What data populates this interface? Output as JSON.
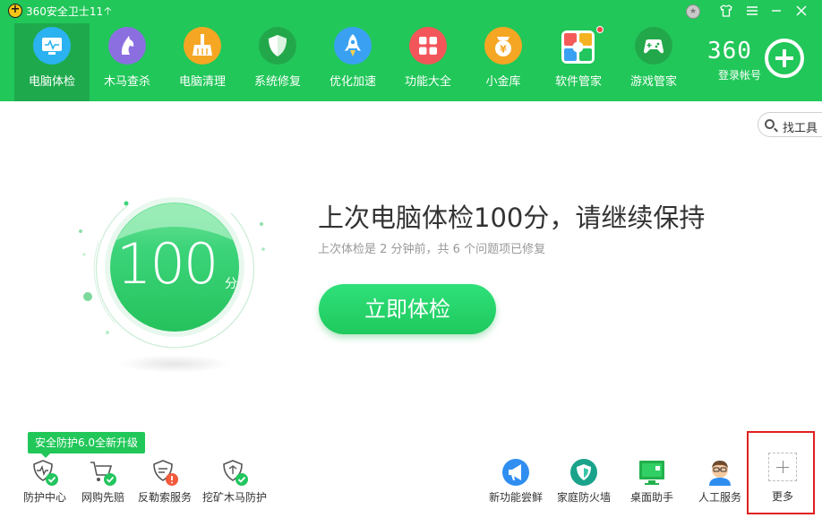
{
  "titlebar": {
    "title": "360安全卫士11",
    "update_icon": "up-arrow-icon",
    "controls": [
      "medal-icon",
      "skin-icon",
      "menu-icon",
      "minimize-icon",
      "close-icon"
    ]
  },
  "nav": {
    "tabs": [
      {
        "label": "电脑体检",
        "icon": "monitor-check-icon",
        "color": "#2bb2f0",
        "active": true
      },
      {
        "label": "木马查杀",
        "icon": "horse-icon",
        "color": "#8b6fe0"
      },
      {
        "label": "电脑清理",
        "icon": "broom-icon",
        "color": "#f5a623"
      },
      {
        "label": "系统修复",
        "icon": "shield-icon",
        "color": "#22a84a"
      },
      {
        "label": "优化加速",
        "icon": "rocket-icon",
        "color": "#3aa1f2"
      },
      {
        "label": "功能大全",
        "icon": "grid-icon",
        "color": "#f2555a"
      },
      {
        "label": "小金库",
        "icon": "coin-icon",
        "color": "#f5a623"
      },
      {
        "label": "软件管家",
        "icon": "apps-icon",
        "color": "#ffffff"
      },
      {
        "label": "游戏管家",
        "icon": "gamepad-icon",
        "color": "#22a84a"
      }
    ],
    "login": {
      "brand": "360",
      "label": "登录帐号"
    }
  },
  "main": {
    "find_tools": "找工具",
    "score": "100",
    "score_unit": "分",
    "headline": "上次电脑体检100分，请继续保持",
    "subline": "上次体检是 2 分钟前，共 6 个问题项已修复",
    "cta": "立即体检"
  },
  "bottom": {
    "promo": "安全防护6.0全新升级",
    "left_tools": [
      {
        "label": "防护中心",
        "icon": "protection-center-icon"
      },
      {
        "label": "网购先赔",
        "icon": "shopping-cart-icon"
      },
      {
        "label": "反勒索服务",
        "icon": "anti-ransomware-icon"
      },
      {
        "label": "挖矿木马防护",
        "icon": "mining-trojan-shield-icon"
      }
    ],
    "right_tools": [
      {
        "label": "新功能尝鲜",
        "icon": "megaphone-icon"
      },
      {
        "label": "家庭防火墙",
        "icon": "family-firewall-icon"
      },
      {
        "label": "桌面助手",
        "icon": "desktop-assistant-icon"
      },
      {
        "label": "人工服务",
        "icon": "agent-avatar-icon"
      }
    ],
    "more": "更多"
  },
  "colors": {
    "brand_green": "#21c759",
    "active_tab": "#1eaa4c",
    "highlight_red": "#e02020"
  }
}
